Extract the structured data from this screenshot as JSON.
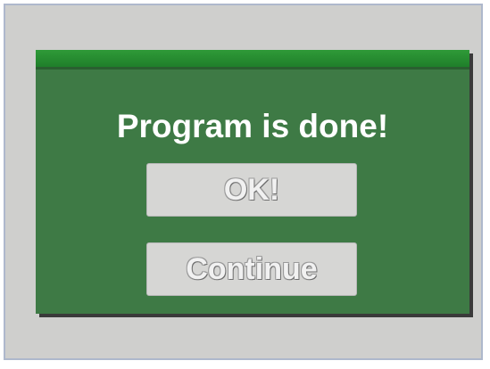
{
  "dialog": {
    "message": "Program is done!",
    "buttons": {
      "ok_label": "OK!",
      "continue_label": "Continue"
    }
  },
  "colors": {
    "screen_background": "#cfcfcd",
    "dialog_background": "#3e7a45",
    "titlebar": "#2f9a38",
    "button_background": "#d6d6d4",
    "message_text": "#ffffff"
  }
}
